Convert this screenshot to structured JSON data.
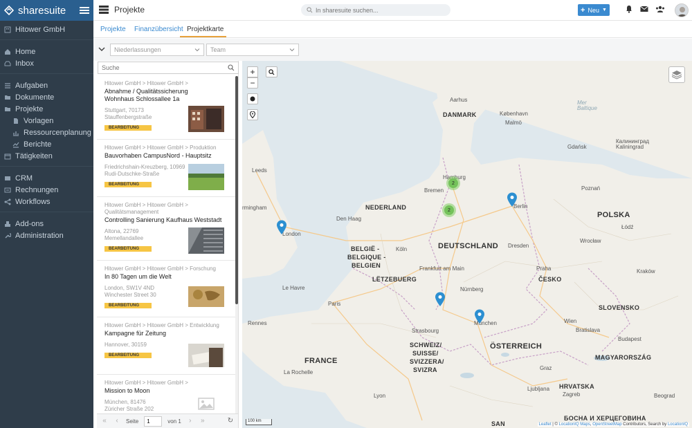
{
  "app": {
    "name": "sharesuite"
  },
  "sidebar": {
    "company": "Hitower GmbH",
    "items": [
      {
        "label": "Home"
      },
      {
        "label": "Inbox"
      },
      {
        "label": "Aufgaben"
      },
      {
        "label": "Dokumente"
      },
      {
        "label": "Projekte"
      },
      {
        "label": "Vorlagen"
      },
      {
        "label": "Ressourcenplanung"
      },
      {
        "label": "Berichte"
      },
      {
        "label": "Tätigkeiten"
      },
      {
        "label": "CRM"
      },
      {
        "label": "Rechnungen"
      },
      {
        "label": "Workflows"
      },
      {
        "label": "Add-ons"
      },
      {
        "label": "Administration"
      }
    ]
  },
  "header": {
    "title": "Projekte",
    "search_placeholder": "In sharesuite suchen...",
    "new_label": "Neu"
  },
  "tabs": [
    {
      "label": "Projekte"
    },
    {
      "label": "Finanzübersicht"
    },
    {
      "label": "Projektkarte"
    }
  ],
  "filters": {
    "location_placeholder": "Niederlassungen",
    "team_placeholder": "Team"
  },
  "list": {
    "search_placeholder": "Suche",
    "projects": [
      {
        "crumb": "Hitower GmbH > Hitower GmbH >",
        "title": "Abnahme / Qualitätssicherung Wohnhaus Schlossallee 1a",
        "addr1": "Stuttgart, 70173",
        "addr2": "Stauffenbergstraße",
        "status": "BEARBEITUNG"
      },
      {
        "crumb": "Hitower GmbH > Hitower GmbH > Produktion",
        "title": "Bauvorhaben CampusNord - Hauptsitz",
        "addr1": "Friedrichshain-Kreuzberg, 10969",
        "addr2": "Rudi-Dutschke-Straße",
        "status": "BEARBEITUNG"
      },
      {
        "crumb": "Hitower GmbH > Hitower GmbH > Qualitätsmanagement",
        "title": "Controlling Sanierung Kaufhaus Weststadt",
        "addr1": "Altona, 22769",
        "addr2": "Memellandallee",
        "status": "BEARBEITUNG"
      },
      {
        "crumb": "Hitower GmbH > Hitower GmbH > Forschung",
        "title": "In 80 Tagen um die Welt",
        "addr1": "London, SW1V 4ND",
        "addr2": "Winchester Street 30",
        "status": "BEARBEITUNG"
      },
      {
        "crumb": "Hitower GmbH > Hitower GmbH > Entwicklung",
        "title": "Kampagne für Zeitung",
        "addr1": "Hannover, 30159",
        "addr2": "",
        "status": "BEARBEITUNG"
      },
      {
        "crumb": "Hitower GmbH > Hitower GmbH >",
        "title": "Mission to Moon",
        "addr1": "München, 81476",
        "addr2": "Züricher Straße 202",
        "status": ""
      }
    ],
    "pager": {
      "page_label": "Seite",
      "page_value": "1",
      "of_label": "von 1"
    }
  },
  "map": {
    "zoom_in": "+",
    "zoom_out": "−",
    "clusters": [
      {
        "count": "2"
      },
      {
        "count": "2"
      }
    ],
    "labels": {
      "danmark": "DANMARK",
      "kobenhavn": "København",
      "aarhus": "Aarhus",
      "nederland": "NEDERLAND",
      "deutschland": "DEUTSCHLAND",
      "belgie1": "BELGIË -",
      "belgie2": "BELGIQUE -",
      "belgie3": "BELGIEN",
      "letzebuerg": "LËTZEBUERG",
      "france": "FRANCE",
      "schweiz1": "SCHWEIZ/",
      "schweiz2": "SUISSE/",
      "schweiz3": "SVIZZERA/",
      "schweiz4": "SVIZRA",
      "oesterreich": "ÖSTERREICH",
      "polska": "POLSKA",
      "cesko": "ČESKO",
      "slovensko": "SLOVENSKO",
      "magyar": "MAGYARORSZÁG",
      "hrvatska": "HRVATSKA",
      "bih": "БОСНА И ХЕРЦЕГОВИНА",
      "san": "SAN",
      "malmo": "Malmö",
      "hamburg": "Hamburg",
      "bremen": "Bremen",
      "berlin": "Berlin",
      "leeds": "Leeds",
      "birmingham": "rmingham",
      "london": "London",
      "denhaag": "Den Haag",
      "koeln": "Köln",
      "frankfurt": "Frankfurt am Main",
      "nuernberg": "Nürnberg",
      "strasbourg": "Strasbourg",
      "muenchen": "München",
      "dresden": "Dresden",
      "paris": "Paris",
      "rennes": "Rennes",
      "lehavre": "Le Havre",
      "lyon": "Lyon",
      "larochelle": "La Rochelle",
      "zagreb": "Zagreb",
      "wien": "Wien",
      "budapest": "Budapest",
      "poznan": "Poznań",
      "praha": "Praha",
      "gdansk": "Gdańsk",
      "kaliningrad1": "Калининград",
      "kaliningrad2": "Kaliningrad",
      "lodz": "Łódź",
      "wroclaw": "Wrocław",
      "krakow": "Kraków",
      "balt1": "Mer",
      "balt2": "Baltique",
      "bratislava": "Bratislava",
      "graz": "Graz",
      "ljubljana": "Ljubljana",
      "beograd": "Beograd"
    },
    "scale": "100 km",
    "attribution": {
      "leaflet": "Leaflet",
      "sep": " | © ",
      "locationiq": "LocationIQ Maps",
      "comma": ", ",
      "osm": "OpenStreetMap",
      "rest": " Contributors, Search by ",
      "liq": "LocationIQ"
    }
  },
  "colors": {
    "sidebar_bg": "#2f3d4a",
    "brand_bg": "#2a5f8f",
    "accent": "#3a8ad0",
    "tab_active_underline": "#e8a23c",
    "badge": "#f6c544",
    "cluster": "#74c25a",
    "pin": "#2c8fd1"
  }
}
